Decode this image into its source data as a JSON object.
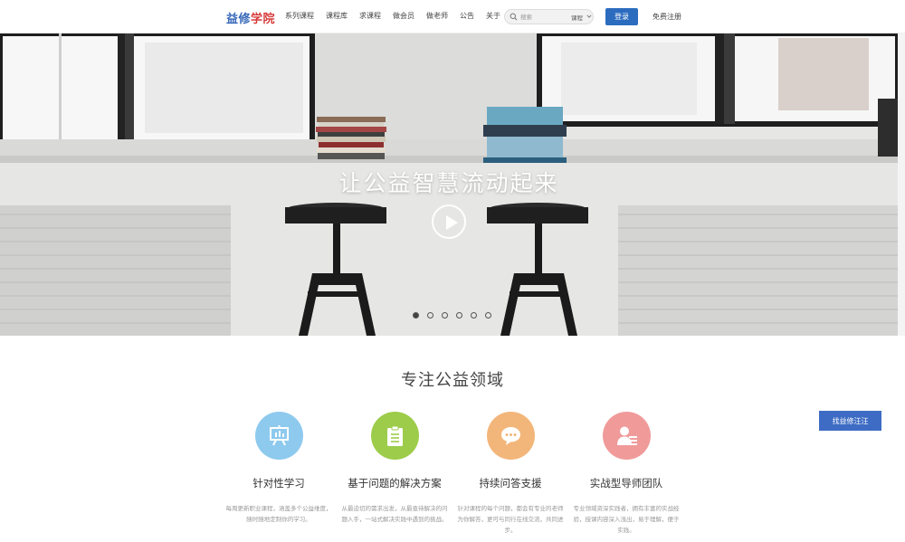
{
  "header": {
    "logo": {
      "part1": "益修",
      "part2": "学院"
    },
    "nav": [
      "系列课程",
      "课程库",
      "求课程",
      "做会员",
      "做老师",
      "公告",
      "关于"
    ],
    "search": {
      "placeholder": "搜索",
      "type_selected": "课程"
    },
    "login_label": "登录",
    "register_label": "免费注册"
  },
  "hero": {
    "title": "让公益智慧流动起来",
    "slides_count": 6,
    "active_slide": 1
  },
  "section": {
    "title": "专注公益领域",
    "features": [
      {
        "icon": "presentation-board-icon",
        "color": "#8ec9ee",
        "title": "针对性学习",
        "desc": "每周更新职业课程，涵盖多个公益维度，随时随地定制你的学习。"
      },
      {
        "icon": "clipboard-icon",
        "color": "#9ccc4a",
        "title": "基于问题的解决方案",
        "desc": "从最迫切的需求出发，从最亟待解决的问题入手，一站式解决实践中遇到的挑战。"
      },
      {
        "icon": "chat-bubble-icon",
        "color": "#f3b67a",
        "title": "持续问答支援",
        "desc": "针对课程的每个问题，都会有专业的老师为你解答，更可与同行在线交流，共同进步。"
      },
      {
        "icon": "mentor-icon",
        "color": "#f09a9a",
        "title": "实战型导师团队",
        "desc": "专业领域资深实践者，拥有丰富的实战经验，授课内容深入浅出，易于理解，便于实践。"
      }
    ]
  },
  "float_button_label": "找益修汪汪",
  "colors": {
    "primary": "#2b6cbf",
    "logo_blue": "#3566b8",
    "logo_red": "#d63a3a"
  }
}
